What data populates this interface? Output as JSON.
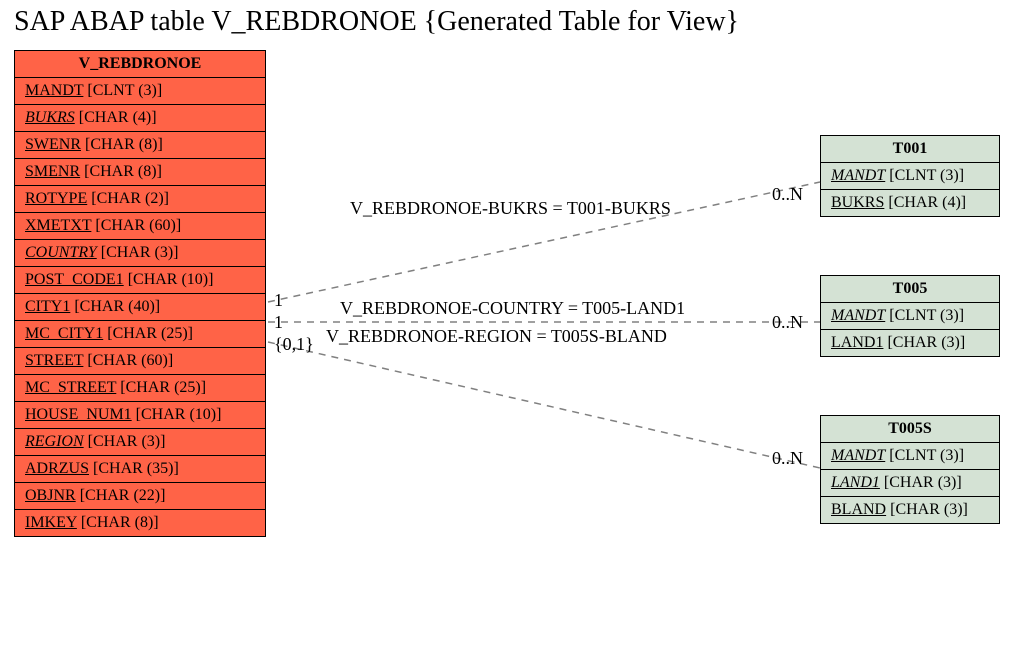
{
  "title": "SAP ABAP table V_REBDRONOE {Generated Table for View}",
  "main_entity": {
    "name": "V_REBDRONOE",
    "fields": [
      {
        "name": "MANDT",
        "type": "[CLNT (3)]",
        "italic": false
      },
      {
        "name": "BUKRS",
        "type": "[CHAR (4)]",
        "italic": true
      },
      {
        "name": "SWENR",
        "type": "[CHAR (8)]",
        "italic": false
      },
      {
        "name": "SMENR",
        "type": "[CHAR (8)]",
        "italic": false
      },
      {
        "name": "ROTYPE",
        "type": "[CHAR (2)]",
        "italic": false
      },
      {
        "name": "XMETXT",
        "type": "[CHAR (60)]",
        "italic": false
      },
      {
        "name": "COUNTRY",
        "type": "[CHAR (3)]",
        "italic": true
      },
      {
        "name": "POST_CODE1",
        "type": "[CHAR (10)]",
        "italic": false
      },
      {
        "name": "CITY1",
        "type": "[CHAR (40)]",
        "italic": false
      },
      {
        "name": "MC_CITY1",
        "type": "[CHAR (25)]",
        "italic": false
      },
      {
        "name": "STREET",
        "type": "[CHAR (60)]",
        "italic": false
      },
      {
        "name": "MC_STREET",
        "type": "[CHAR (25)]",
        "italic": false
      },
      {
        "name": "HOUSE_NUM1",
        "type": "[CHAR (10)]",
        "italic": false
      },
      {
        "name": "REGION",
        "type": "[CHAR (3)]",
        "italic": true
      },
      {
        "name": "ADRZUS",
        "type": "[CHAR (35)]",
        "italic": false
      },
      {
        "name": "OBJNR",
        "type": "[CHAR (22)]",
        "italic": false
      },
      {
        "name": "IMKEY",
        "type": "[CHAR (8)]",
        "italic": false
      }
    ]
  },
  "ref_entities": [
    {
      "name": "T001",
      "fields": [
        {
          "name": "MANDT",
          "type": "[CLNT (3)]",
          "italic": true
        },
        {
          "name": "BUKRS",
          "type": "[CHAR (4)]",
          "italic": false
        }
      ]
    },
    {
      "name": "T005",
      "fields": [
        {
          "name": "MANDT",
          "type": "[CLNT (3)]",
          "italic": true
        },
        {
          "name": "LAND1",
          "type": "[CHAR (3)]",
          "italic": false
        }
      ]
    },
    {
      "name": "T005S",
      "fields": [
        {
          "name": "MANDT",
          "type": "[CLNT (3)]",
          "italic": true
        },
        {
          "name": "LAND1",
          "type": "[CHAR (3)]",
          "italic": true
        },
        {
          "name": "BLAND",
          "type": "[CHAR (3)]",
          "italic": false
        }
      ]
    }
  ],
  "relations": [
    {
      "label": "V_REBDRONOE-BUKRS = T001-BUKRS",
      "left_card": "1",
      "right_card": "0..N"
    },
    {
      "label": "V_REBDRONOE-COUNTRY = T005-LAND1",
      "left_card": "1",
      "right_card": "0..N"
    },
    {
      "label": "V_REBDRONOE-REGION = T005S-BLAND",
      "left_card": "{0,1}",
      "right_card": "0..N"
    }
  ]
}
